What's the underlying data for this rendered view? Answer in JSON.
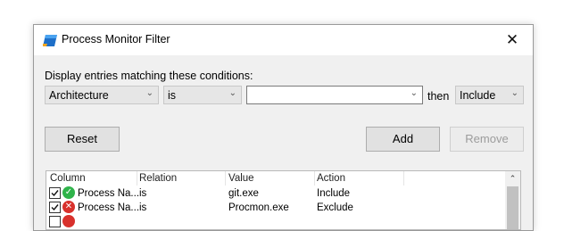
{
  "window": {
    "title": "Process Monitor Filter",
    "close_glyph": "✕",
    "accent": "#1e6fc8"
  },
  "filter": {
    "prompt": "Display entries matching these conditions:",
    "column_value": "Architecture",
    "relation_value": "is",
    "value_text": "",
    "then_label": "then",
    "action_value": "Include"
  },
  "buttons": {
    "reset": "Reset",
    "add": "Add",
    "remove": "Remove"
  },
  "list": {
    "headers": [
      "Column",
      "Relation",
      "Value",
      "Action"
    ],
    "rows": [
      {
        "checked": true,
        "status": "include",
        "status_color": "#2fb34a",
        "column": "Process Na...",
        "relation": "is",
        "value": "git.exe",
        "action": "Include"
      },
      {
        "checked": true,
        "status": "exclude",
        "status_color": "#d8312c",
        "column": "Process Na...",
        "relation": "is",
        "value": "Procmon.exe",
        "action": "Exclude"
      }
    ]
  }
}
